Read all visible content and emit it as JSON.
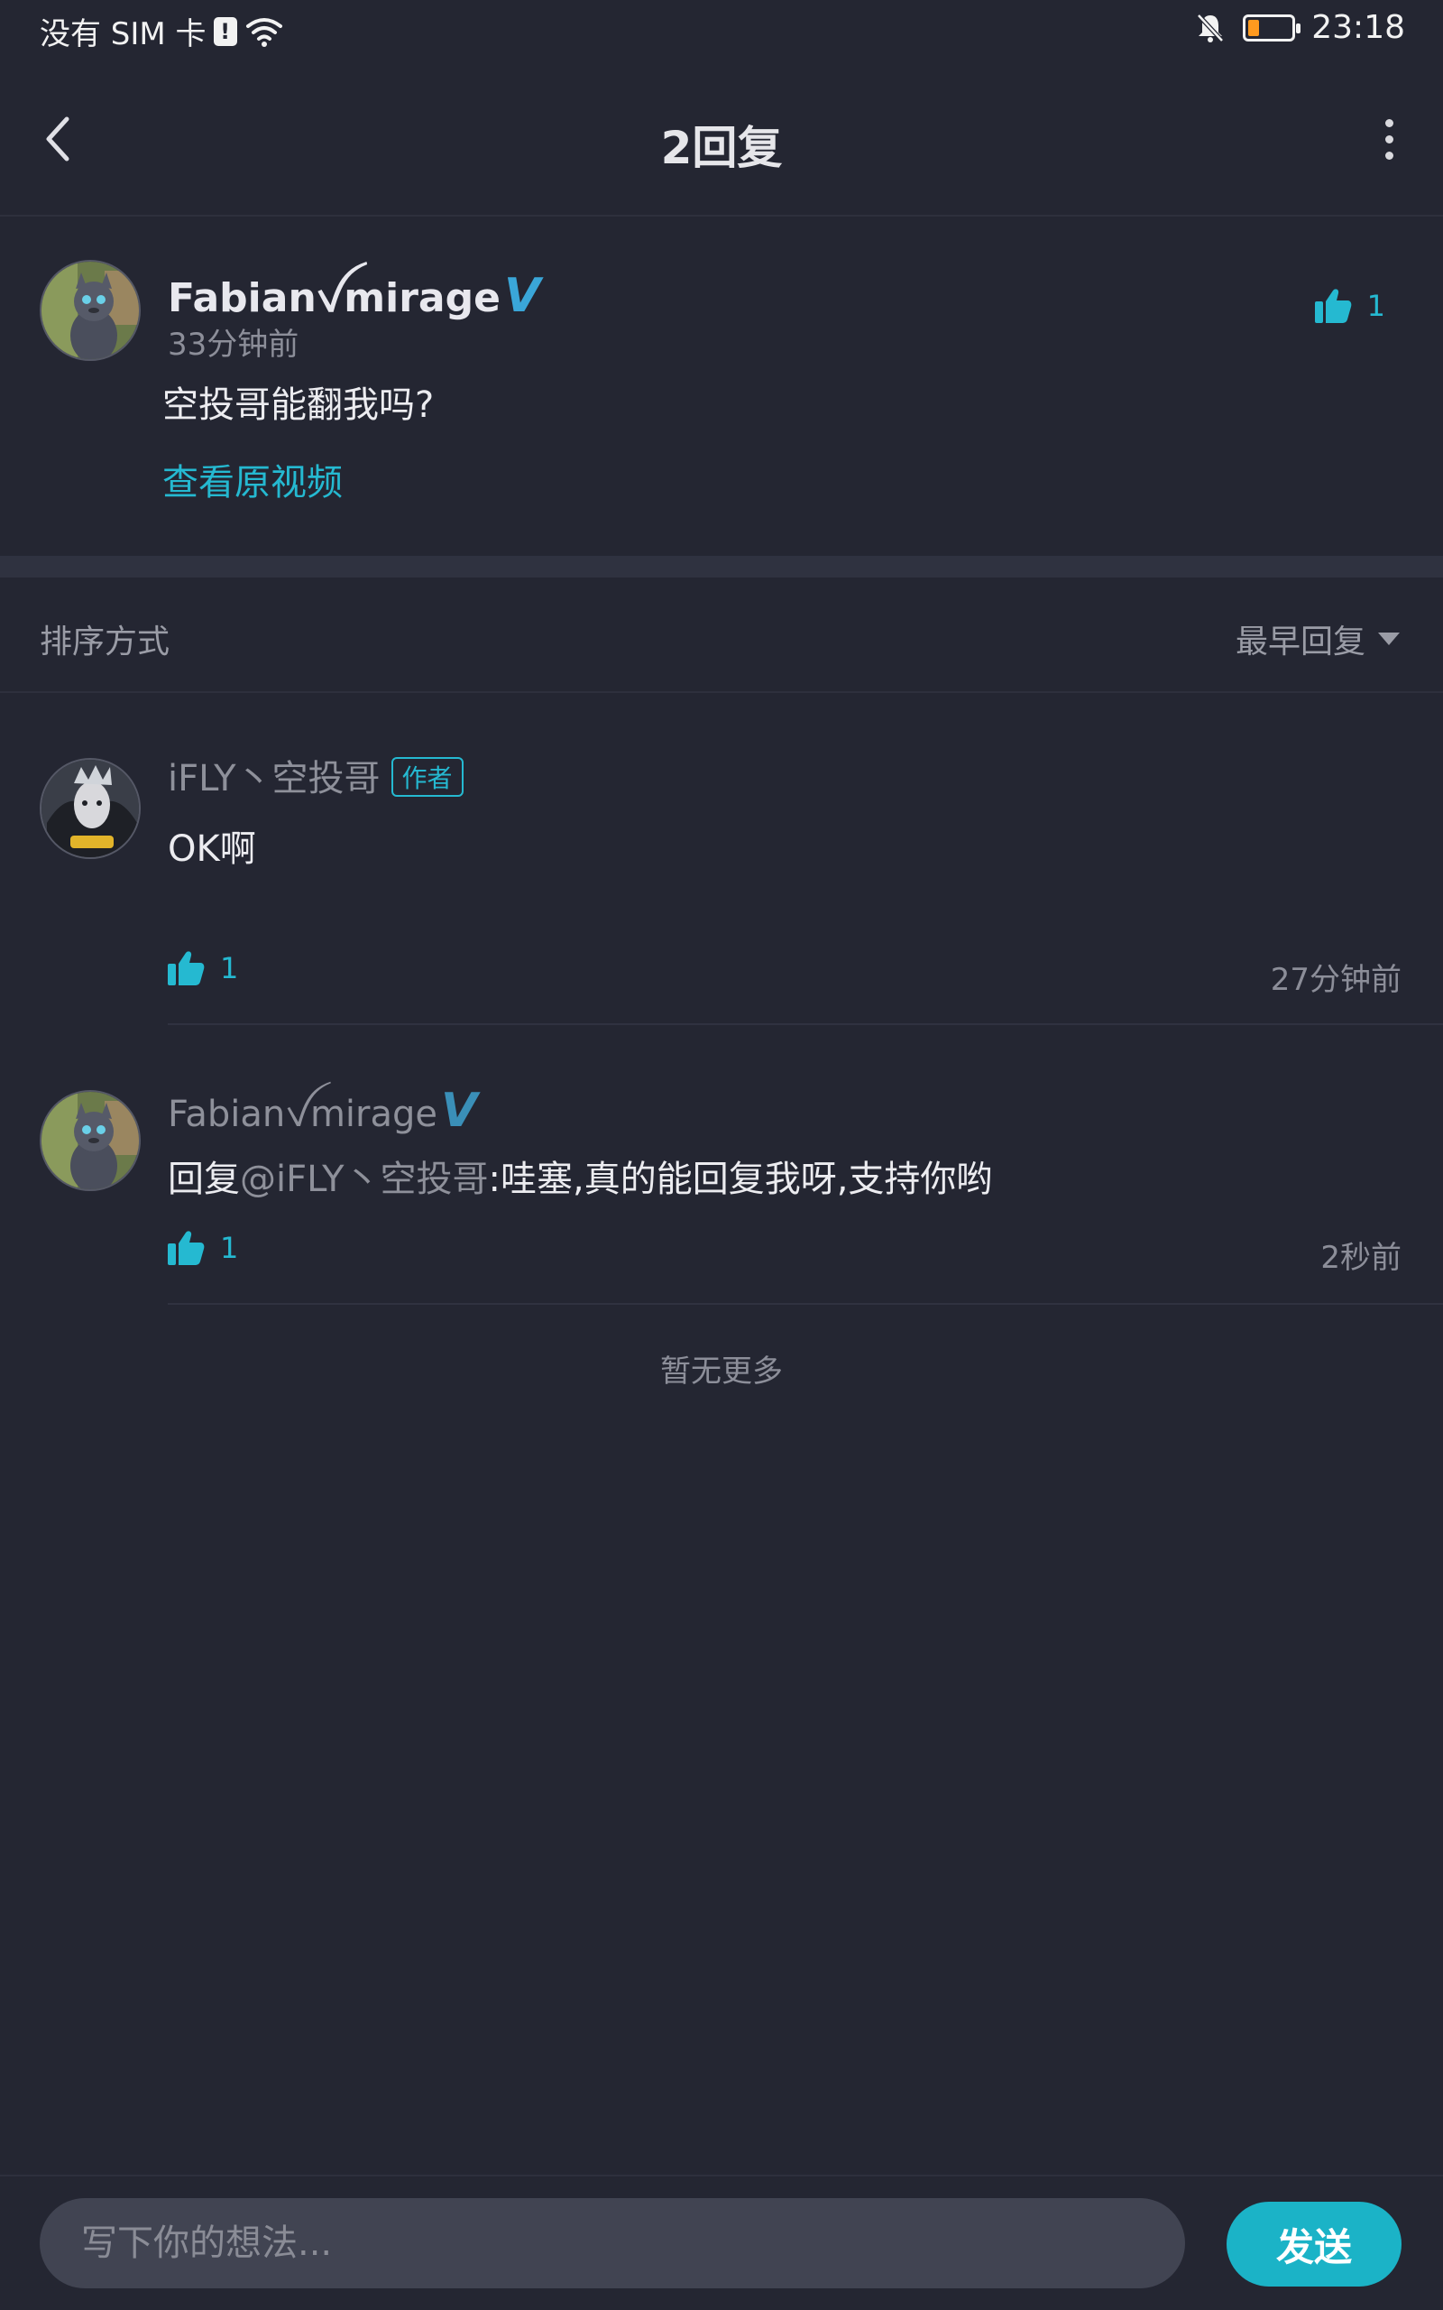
{
  "status_bar": {
    "carrier": "没有 SIM 卡",
    "time": "23:18",
    "battery_color": "#ff9a1f"
  },
  "nav": {
    "title": "2回复",
    "back_icon": "chevron-left-icon",
    "more_icon": "more-vertical-icon"
  },
  "main_comment": {
    "username": "Fabianꪜmirage",
    "verified_mark": "V",
    "time": "33分钟前",
    "content": "空投哥能翻我吗?",
    "view_video_link": "查看原视频",
    "like_count": "1"
  },
  "sort": {
    "label": "排序方式",
    "selected": "最早回复"
  },
  "replies": [
    {
      "username": "iFLY丶空投哥",
      "badge": "作者",
      "content": "OK啊",
      "like_count": "1",
      "time": "27分钟前"
    },
    {
      "username": "Fabianꪜmirage",
      "verified_mark": "V",
      "reply_prefix": "回复",
      "mention": "@iFLY丶空投哥",
      "content": ":哇塞,真的能回复我呀,支持你哟",
      "like_count": "1",
      "time": "2秒前"
    }
  ],
  "footer_note": "暂无更多",
  "input": {
    "placeholder": "写下你的想法...",
    "send_label": "发送"
  },
  "colors": {
    "accent": "#25b9d1",
    "background": "#242632",
    "send_button": "#1bb3c7"
  }
}
